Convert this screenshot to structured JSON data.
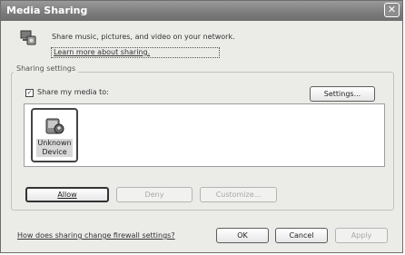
{
  "window": {
    "title": "Media Sharing",
    "close_glyph": "✕"
  },
  "header": {
    "icon": "media-share-icon",
    "description": "Share music, pictures, and video on your network.",
    "learn_more": "Learn more about sharing."
  },
  "sharing_settings": {
    "group_label": "Sharing settings",
    "share_media_label": "Share my media to:",
    "share_media_checked": true,
    "settings_button": "Settings...",
    "devices": [
      {
        "icon": "unknown-device-icon",
        "line1": "Unknown",
        "line2": "Device",
        "selected": true
      }
    ],
    "allow_button": "Allow",
    "deny_button": "Deny",
    "customize_button": "Customize..."
  },
  "footer": {
    "firewall_link": "How does sharing change firewall settings?",
    "ok_button": "OK",
    "cancel_button": "Cancel",
    "apply_button": "Apply"
  }
}
